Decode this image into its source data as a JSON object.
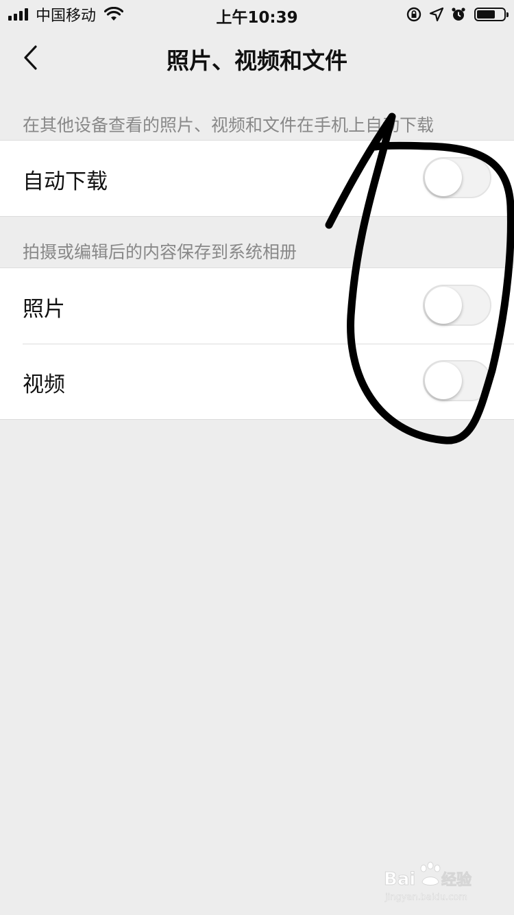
{
  "status_bar": {
    "carrier": "中国移动",
    "time": "上午10:39"
  },
  "nav": {
    "title": "照片、视频和文件"
  },
  "sections": [
    {
      "header": "在其他设备查看的照片、视频和文件在手机上自动下载",
      "rows": [
        {
          "label": "自动下载",
          "switch_on": false
        }
      ]
    },
    {
      "header": "拍摄或编辑后的内容保存到系统相册",
      "rows": [
        {
          "label": "照片",
          "switch_on": false
        },
        {
          "label": "视频",
          "switch_on": false
        }
      ]
    }
  ],
  "colors": {
    "background": "#ededed",
    "card": "#ffffff",
    "annotation_stroke": "#000000"
  }
}
